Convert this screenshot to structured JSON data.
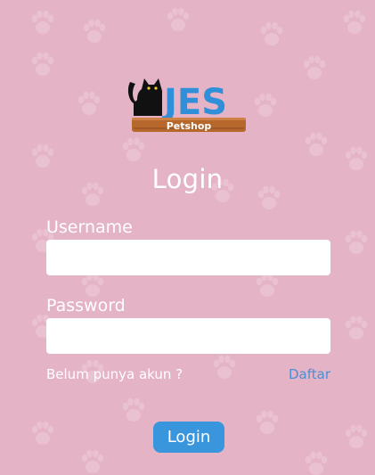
{
  "brand": {
    "logo_text": "JES",
    "logo_sub": "Petshop"
  },
  "form": {
    "title": "Login",
    "username_label": "Username",
    "username_value": "",
    "password_label": "Password",
    "password_value": "",
    "no_account_text": "Belum punya akun ?",
    "register_label": "Daftar",
    "login_button_label": "Login"
  },
  "colors": {
    "background": "#e4b3c6",
    "paw_pattern": "#eac2d2",
    "accent_button": "#3a96dc",
    "link": "#4a8fd6",
    "logo_blue": "#2f8fd8",
    "logo_plank": "#b5672c"
  }
}
